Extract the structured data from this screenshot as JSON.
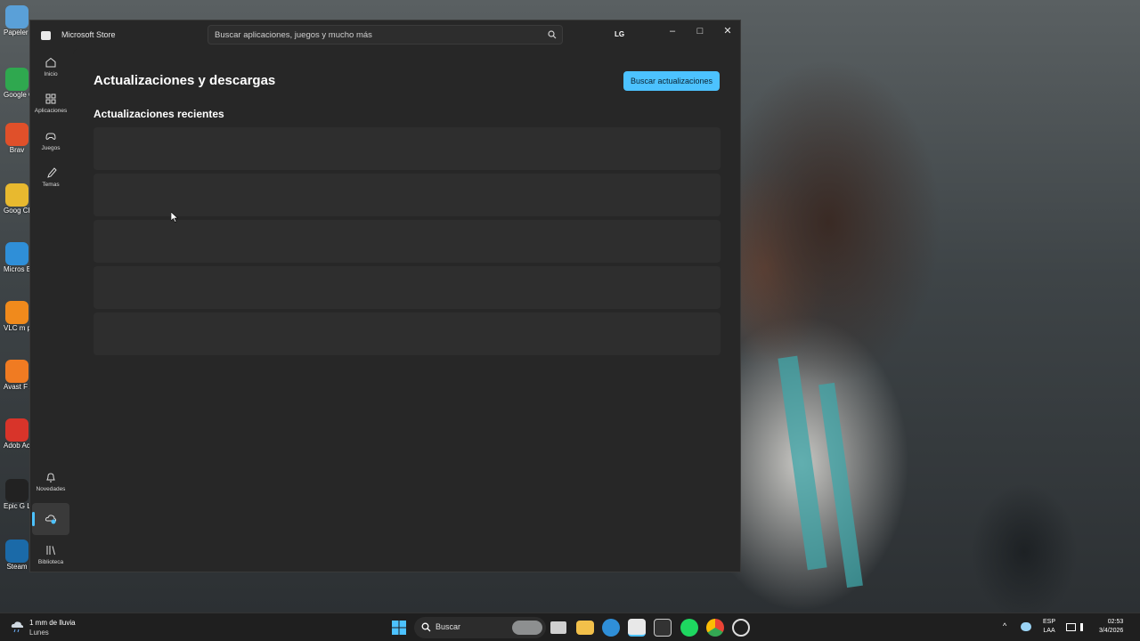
{
  "desktop": {
    "icons": [
      {
        "label": "Papeler recicla",
        "color": "#5aa0d8"
      },
      {
        "label": "Google Game",
        "color": "#2fa84f"
      },
      {
        "label": "Brav",
        "color": "#e0502a"
      },
      {
        "label": "Goog Chron",
        "color": "#e8b92f"
      },
      {
        "label": "Micros Edge",
        "color": "#2f8fd8"
      },
      {
        "label": "VLC m playe",
        "color": "#f08a1c"
      },
      {
        "label": "Avast F Antivi",
        "color": "#f07b22"
      },
      {
        "label": "Adob Acro",
        "color": "#d8342a"
      },
      {
        "label": "Epic G Launc",
        "color": "#222222"
      },
      {
        "label": "Steam",
        "color": "#1b6aa8"
      }
    ]
  },
  "window": {
    "app_title": "Microsoft Store",
    "search_placeholder": "Buscar aplicaciones, juegos y mucho más",
    "avatar": "LG",
    "controls": {
      "minimize": "–",
      "maximize": "□",
      "close": "✕"
    }
  },
  "sidebar": {
    "top_items": [
      {
        "label": "Inicio",
        "icon": "home-icon"
      },
      {
        "label": "Aplicaciones",
        "icon": "apps-icon"
      },
      {
        "label": "Juegos",
        "icon": "gamepad-icon"
      },
      {
        "label": "Temas",
        "icon": "brush-icon"
      }
    ],
    "bottom_items": [
      {
        "label": "Novedades",
        "icon": "bell-icon"
      },
      {
        "label": "",
        "icon": "downloads-icon",
        "active": true
      },
      {
        "label": "Biblioteca",
        "icon": "library-icon"
      }
    ]
  },
  "main": {
    "title": "Actualizaciones y descargas",
    "check_button": "Buscar actualizaciones",
    "section_title": "Actualizaciones recientes",
    "loading_rows": 5
  },
  "taskbar": {
    "weather": {
      "temp": "1 mm de lluvia",
      "desc": "Lunes"
    },
    "search_label": "Buscar",
    "language_top": "ESP",
    "language_bottom": "LAA",
    "time": "02:53",
    "date": "3/4/2026"
  },
  "colors": {
    "accent": "#4cc2ff",
    "window_bg": "#272727",
    "row_bg": "#2e2e2e"
  }
}
